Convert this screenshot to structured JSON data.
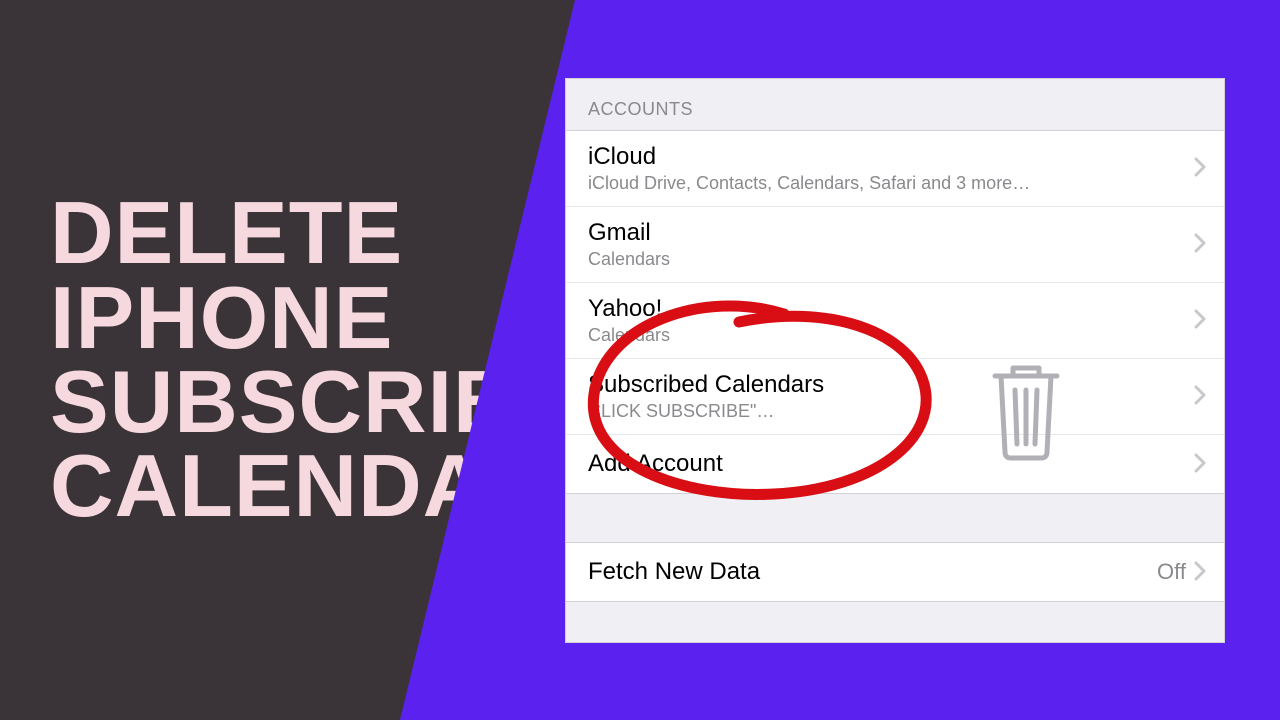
{
  "headline": {
    "line1": "DELETE",
    "line2": "IPHONE",
    "line3": "SUBSCRIBE",
    "line4": "CALENDAR"
  },
  "settings": {
    "section_header": "ACCOUNTS",
    "accounts": [
      {
        "title": "iCloud",
        "subtitle": "iCloud Drive, Contacts, Calendars, Safari and 3 more…"
      },
      {
        "title": "Gmail",
        "subtitle": "Calendars"
      },
      {
        "title": "Yahoo!",
        "subtitle": "Calendars"
      },
      {
        "title": "Subscribed Calendars",
        "subtitle": "CLICK SUBSCRIBE\"…"
      }
    ],
    "add_account_label": "Add Account",
    "fetch": {
      "label": "Fetch New Data",
      "value": "Off"
    }
  }
}
